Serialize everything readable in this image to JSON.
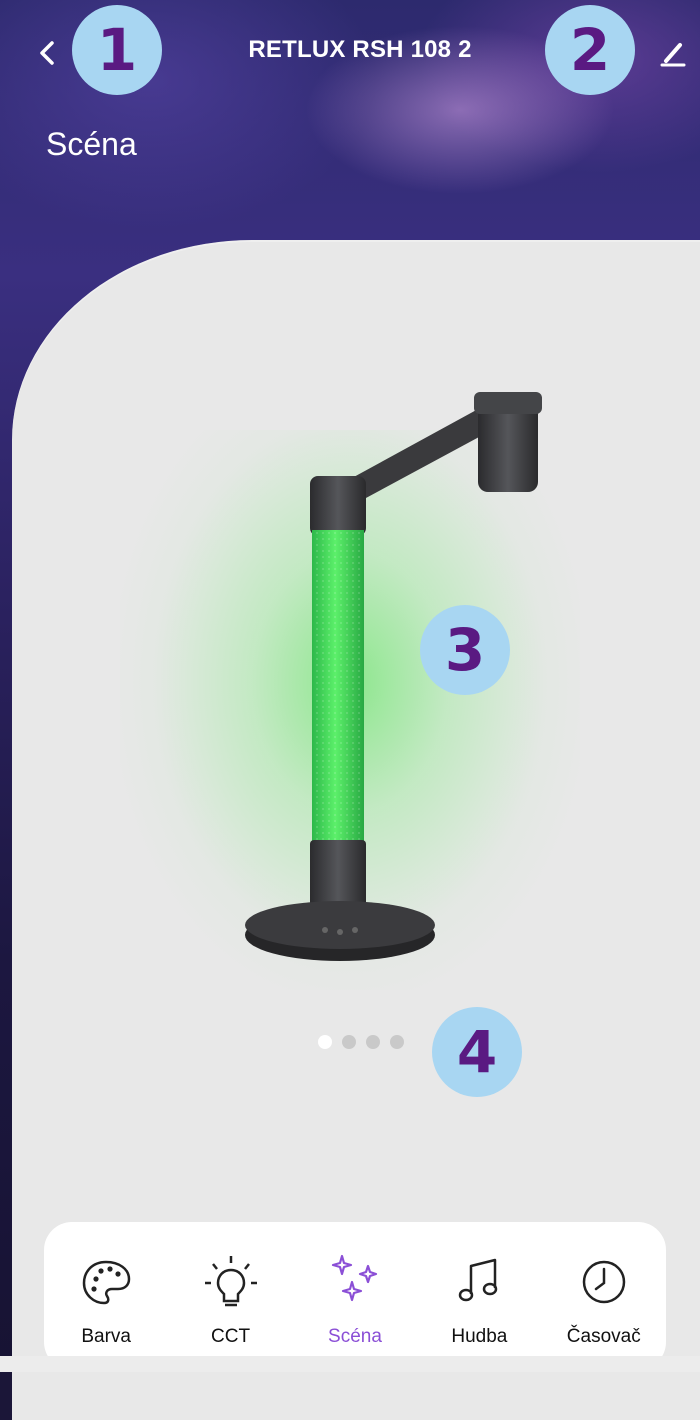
{
  "header": {
    "title": "RETLUX RSH 108 2",
    "subtitle": "Scéna"
  },
  "badges": [
    "1",
    "2",
    "3",
    "4"
  ],
  "device": {
    "glow_color": "#5fe05f",
    "page_indicator": {
      "count": 4,
      "active_index": 0
    }
  },
  "tabs": [
    {
      "label": "Barva",
      "icon": "palette-icon",
      "active": false
    },
    {
      "label": "CCT",
      "icon": "lightbulb-icon",
      "active": false
    },
    {
      "label": "Scéna",
      "icon": "sparkles-icon",
      "active": true
    },
    {
      "label": "Hudba",
      "icon": "music-note-icon",
      "active": false
    },
    {
      "label": "Časovač",
      "icon": "clock-icon",
      "active": false
    }
  ],
  "colors": {
    "accent": "#8b4fd6",
    "badge_bg": "#a8d6f2",
    "badge_text": "#5a1a82"
  }
}
